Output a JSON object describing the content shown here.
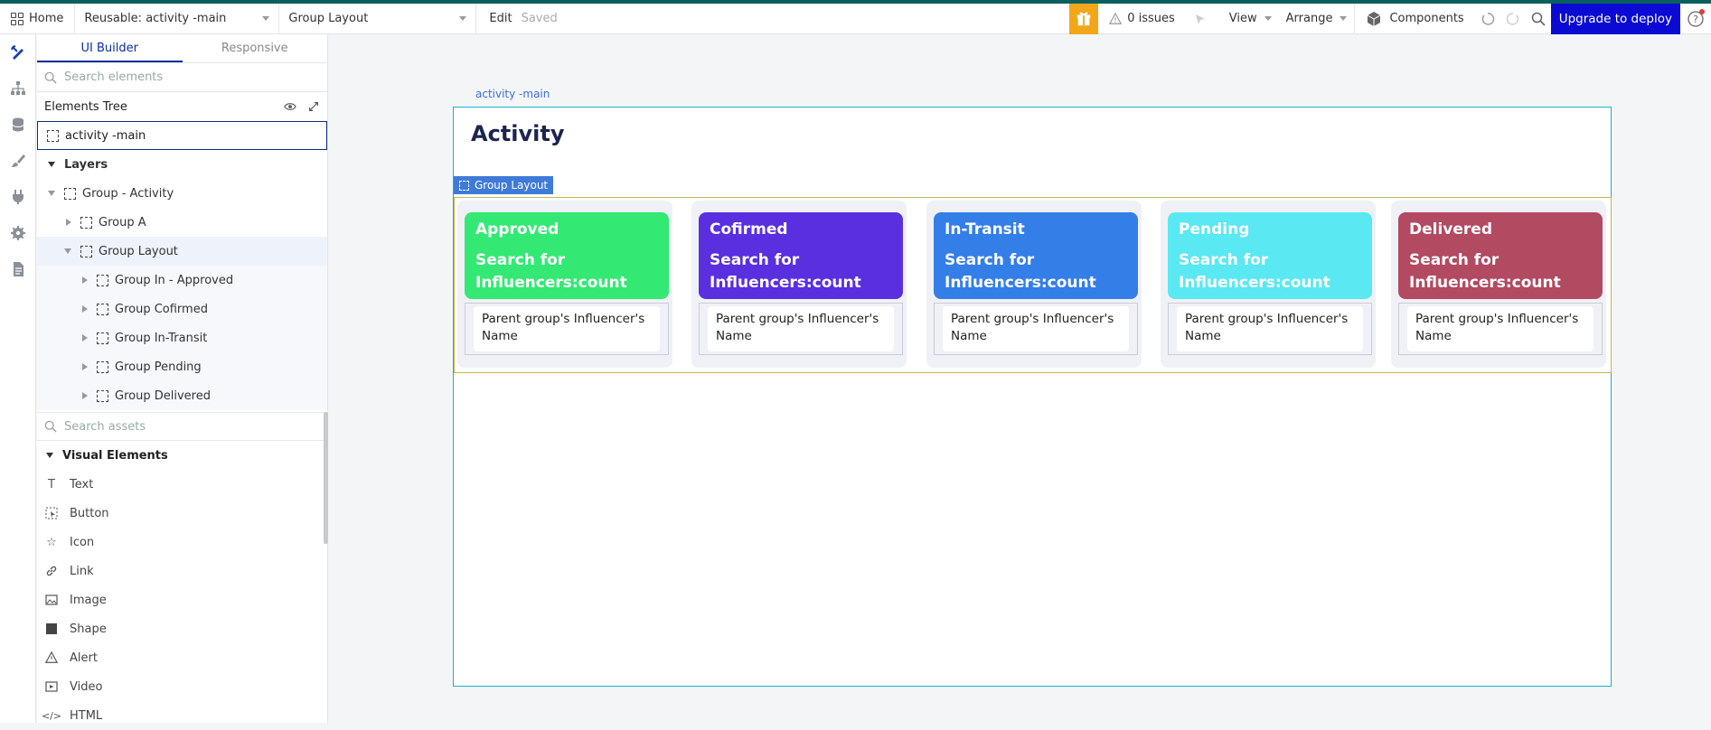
{
  "topbar": {
    "home_label": "Home",
    "page_select": "Reusable: activity -main",
    "element_select": "Group Layout",
    "edit_label": "Edit",
    "saved_label": "Saved",
    "issues_label": "0 issues",
    "view_label": "View",
    "arrange_label": "Arrange",
    "components_label": "Components",
    "upgrade_label": "Upgrade to deploy",
    "gift_color": "#f2a619",
    "upgrade_color": "#0a0ad2"
  },
  "rail": {
    "icons": [
      "design-icon",
      "sitemap-icon",
      "database-icon",
      "brush-icon",
      "plugin-icon",
      "settings-icon",
      "logs-icon"
    ]
  },
  "panel": {
    "tabs": [
      "UI Builder",
      "Responsive"
    ],
    "search_placeholder": "Search elements",
    "tree_title": "Elements Tree",
    "root_item": "activity -main",
    "layers_label": "Layers",
    "group_activity": "Group - Activity",
    "group_a": "Group A",
    "group_layout": "Group Layout",
    "sub_groups": [
      "Group In - Approved",
      "Group Cofirmed",
      "Group In-Transit",
      "Group Pending",
      "Group Delivered"
    ],
    "assets_placeholder": "Search assets",
    "visual_elements_label": "Visual Elements",
    "visual_elements": [
      "Text",
      "Button",
      "Icon",
      "Link",
      "Image",
      "Shape",
      "Alert",
      "Video",
      "HTML"
    ]
  },
  "canvas": {
    "element_label": "activity -main",
    "page_title": "Activity",
    "group_badge": "Group Layout",
    "cards": [
      {
        "title": "Approved",
        "count_text": "Search for Influencers:count",
        "name_text": "Parent group's Influencer's Name",
        "color": "#34e874"
      },
      {
        "title": "Cofirmed",
        "count_text": "Search for Influencers:count",
        "name_text": "Parent group's Influencer's Name",
        "color": "#5a2fe0"
      },
      {
        "title": "In-Transit",
        "count_text": "Search for Influencers:count",
        "name_text": "Parent group's Influencer's Name",
        "color": "#347ee8"
      },
      {
        "title": "Pending",
        "count_text": "Search for Influencers:count",
        "name_text": "Parent group's Influencer's Name",
        "color": "#5ae8f2"
      },
      {
        "title": "Delivered",
        "count_text": "Search for Influencers:count",
        "name_text": "Parent group's Influencer's Name",
        "color": "#b24a62"
      }
    ]
  }
}
